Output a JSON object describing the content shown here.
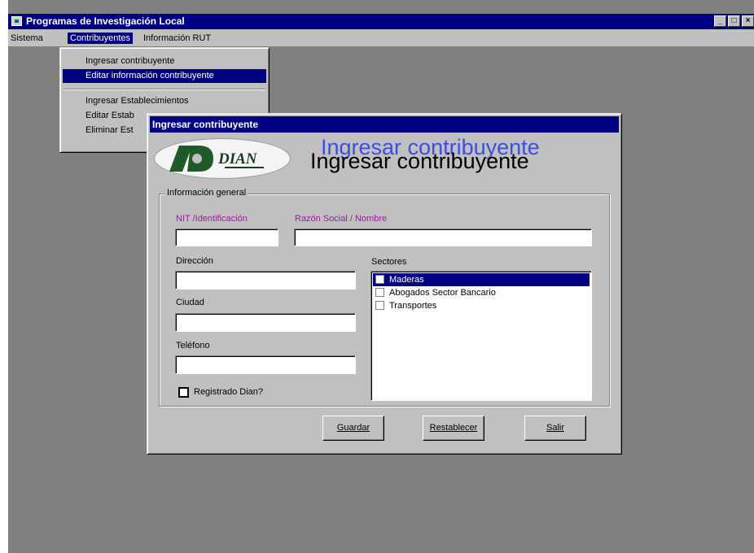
{
  "window": {
    "title": "Programas de Investigación Local",
    "controls": [
      "_",
      "□",
      "×"
    ]
  },
  "menubar": {
    "items": [
      "Sistema",
      "Contribuyentes",
      "Información RUT"
    ],
    "active": "Contribuyentes"
  },
  "dropdown": {
    "items": [
      "Ingresar contribuyente",
      "Editar información contribuyente",
      "Ingresar Establecimientos",
      "Editar Estab",
      "Eliminar Est"
    ],
    "selected": "Editar información contribuyente"
  },
  "dialog": {
    "title": "Ingresar contribuyente",
    "logo_text": "DIAN",
    "heading": "Ingresar contribuyente",
    "group_title": "Información general",
    "fields": {
      "nit_label": "NIT /Identificación",
      "nit_value": "",
      "razon_label": "Razón Social / Nombre",
      "razon_value": "",
      "direccion_label": "Dirección",
      "direccion_value": "",
      "ciudad_label": "Ciudad",
      "ciudad_value": "",
      "telefono_label": "Teléfono",
      "telefono_value": ""
    },
    "sectores": {
      "label": "Sectores",
      "items": [
        "Maderas",
        "Abogados Sector Bancario",
        "Transportes"
      ],
      "selected": "Maderas"
    },
    "checkbox": {
      "label": "Registrado Dian?",
      "checked": false
    },
    "buttons": {
      "save": "Guardar",
      "reset": "Restablecer",
      "exit": "Salir"
    }
  },
  "colors": {
    "titlebar": "#000080",
    "face": "#c0c0c0",
    "desktop": "#808080",
    "field_label": "#9a1aa0",
    "heading_ghost": "#3d4fe0"
  }
}
